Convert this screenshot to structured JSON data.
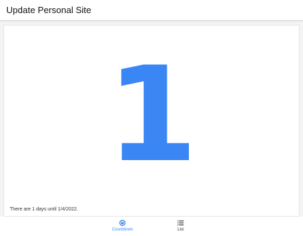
{
  "header": {
    "title": "Update Personal Site"
  },
  "countdown": {
    "value": "1",
    "message": "There are 1 days until 1/4/2022."
  },
  "tabs": [
    {
      "label": "Countdown",
      "icon": "countdown-icon",
      "active": true
    },
    {
      "label": "List",
      "icon": "list-icon",
      "active": false
    }
  ],
  "colors": {
    "accent": "#3b86f5"
  }
}
